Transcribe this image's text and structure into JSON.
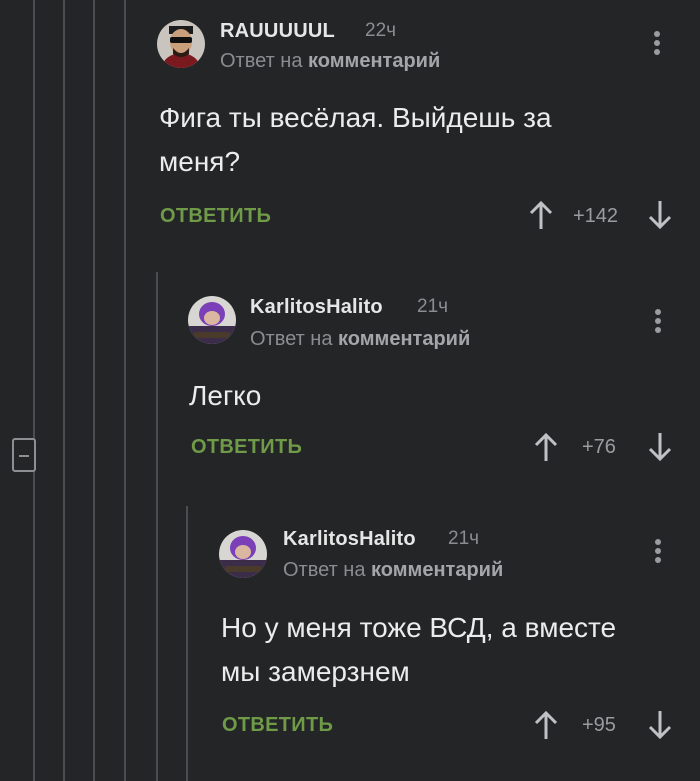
{
  "comments": [
    {
      "author": "RAUUUUUL",
      "time": "22ч",
      "reply_prefix": "Ответ на ",
      "reply_target": "комментарий",
      "text_line1": "Фига ты весёлая. Выйдешь за",
      "text_line2": "меня?",
      "reply_label": "ОТВЕТИТЬ",
      "rating": "+142",
      "avatar": "avatar-man-sunglasses"
    },
    {
      "author": "KarlitosHalito",
      "time": "21ч",
      "reply_prefix": "Ответ на ",
      "reply_target": "комментарий",
      "text_line1": "Легко",
      "reply_label": "ОТВЕТИТЬ",
      "rating": "+76",
      "avatar": "avatar-purple-hair"
    },
    {
      "author": "KarlitosHalito",
      "time": "21ч",
      "reply_prefix": "Ответ на ",
      "reply_target": "комментарий",
      "text_line1": "Но у меня тоже ВСД, а вместе",
      "text_line2": "мы замерзнем",
      "reply_label": "ОТВЕТИТЬ",
      "rating": "+95",
      "avatar": "avatar-purple-hair"
    }
  ],
  "colors": {
    "background": "#232527",
    "reply_green": "#6f9a47",
    "text": "#ececec",
    "muted": "#8a8c8f"
  }
}
